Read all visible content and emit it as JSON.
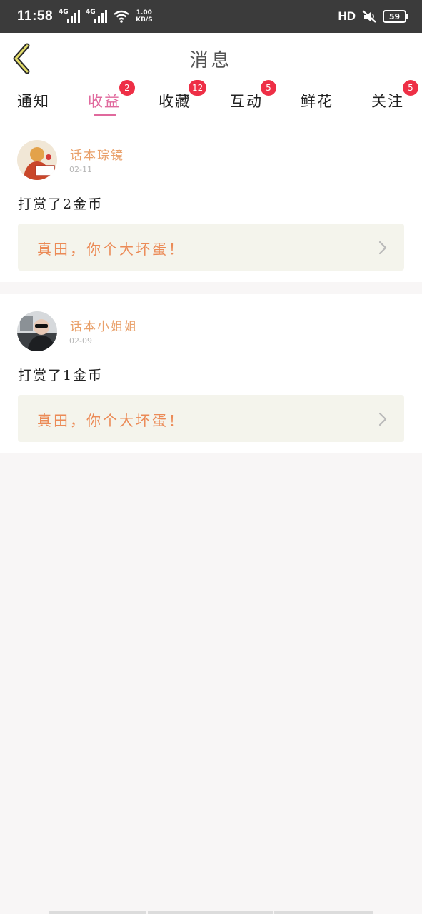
{
  "status_bar": {
    "time": "11:58",
    "network_1": "4G",
    "network_2": "4G",
    "speed_value": "1.00",
    "speed_unit": "KB/S",
    "hd": "HD",
    "battery": "59"
  },
  "header": {
    "title": "消息",
    "back_icon": "chevron-left-icon"
  },
  "tabs": [
    {
      "label": "通知",
      "badge": null,
      "active": false
    },
    {
      "label": "收益",
      "badge": "2",
      "active": true
    },
    {
      "label": "收藏",
      "badge": "12",
      "active": false
    },
    {
      "label": "互动",
      "badge": "5",
      "active": false
    },
    {
      "label": "鲜花",
      "badge": null,
      "active": false
    },
    {
      "label": "关注",
      "badge": "5",
      "active": false
    }
  ],
  "messages": [
    {
      "user": "话本琮镜",
      "date": "02-11",
      "text": "打赏了2金币",
      "quote": "真田，你个大坏蛋！"
    },
    {
      "user": "话本小姐姐",
      "date": "02-09",
      "text": "打赏了1金币",
      "quote": "真田，你个大坏蛋！"
    }
  ],
  "colors": {
    "accent": "#e0699d",
    "badge": "#ee2f46",
    "username": "#e9a06a",
    "quote": "#eb8a56"
  }
}
